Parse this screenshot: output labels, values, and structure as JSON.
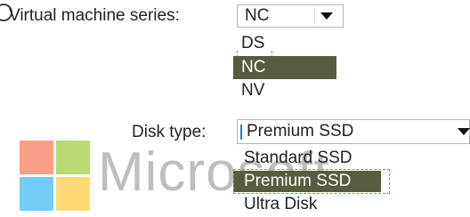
{
  "watermark": {
    "text": "Microsoft",
    "colors": [
      "#f25022",
      "#7fba00",
      "#00a4ef",
      "#ffb900"
    ]
  },
  "vm_series": {
    "label": "Virtual machine series:",
    "selected": "NC",
    "options": [
      "DS",
      "NC",
      "NV"
    ],
    "highlight_color": "#5a5a41"
  },
  "disk_type": {
    "label": "Disk type:",
    "selected": "Premium SSD",
    "options": [
      "Standard SSD",
      "Premium SSD",
      "Ultra Disk"
    ]
  }
}
